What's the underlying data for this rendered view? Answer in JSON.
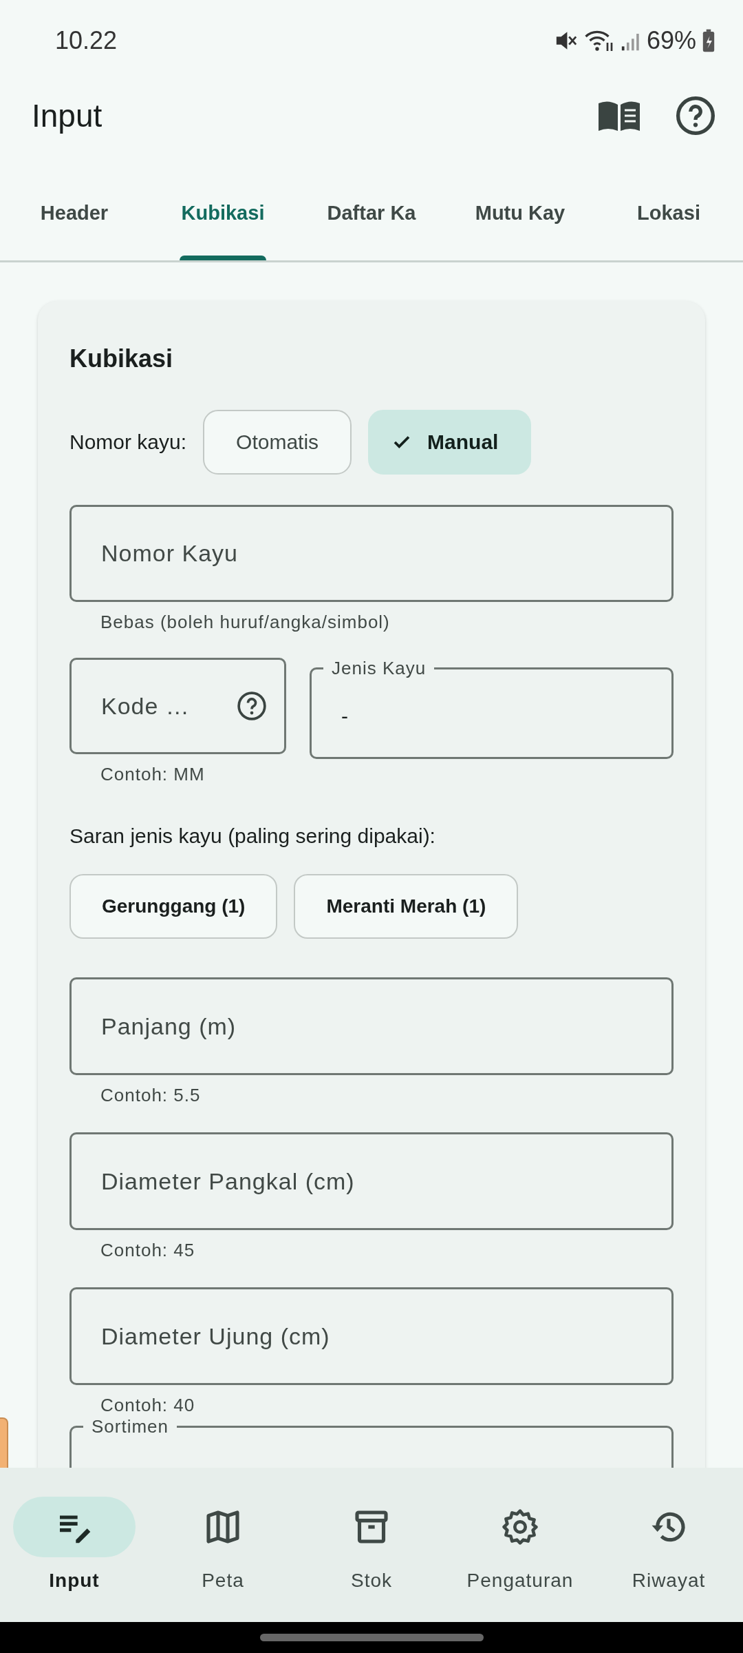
{
  "status_bar": {
    "time": "10.22",
    "battery": "69%"
  },
  "app_bar": {
    "title": "Input"
  },
  "tabs": [
    {
      "label": "Header",
      "selected": false
    },
    {
      "label": "Kubikasi",
      "selected": true
    },
    {
      "label": "Daftar Ka",
      "selected": false
    },
    {
      "label": "Mutu Kay",
      "selected": false
    },
    {
      "label": "Lokasi",
      "selected": false
    }
  ],
  "card": {
    "title": "Kubikasi",
    "nomor_kayu": {
      "label": "Nomor kayu:",
      "options": [
        {
          "label": "Otomatis",
          "selected": false
        },
        {
          "label": "Manual",
          "selected": true
        }
      ]
    },
    "nomor_kayu_field": {
      "placeholder": "Nomor Kayu",
      "helper": "Bebas (boleh huruf/angka/simbol)"
    },
    "kode_field": {
      "placeholder": "Kode …",
      "helper": "Contoh: MM"
    },
    "jenis_kayu_field": {
      "label": "Jenis Kayu",
      "value": "-"
    },
    "suggestions": {
      "label": "Saran jenis kayu (paling sering dipakai):",
      "chips": [
        "Gerunggang (1)",
        "Meranti Merah (1)"
      ]
    },
    "measure_fields": [
      {
        "placeholder": "Panjang (m)",
        "helper": "Contoh: 5.5"
      },
      {
        "placeholder": "Diameter Pangkal (cm)",
        "helper": "Contoh: 45"
      },
      {
        "placeholder": "Diameter Ujung (cm)",
        "helper": "Contoh: 40"
      }
    ],
    "sortimen_field": {
      "label": "Sortimen"
    }
  },
  "bottom_nav": [
    {
      "label": "Input",
      "selected": true
    },
    {
      "label": "Peta",
      "selected": false
    },
    {
      "label": "Stok",
      "selected": false
    },
    {
      "label": "Pengaturan",
      "selected": false
    },
    {
      "label": "Riwayat",
      "selected": false
    }
  ]
}
